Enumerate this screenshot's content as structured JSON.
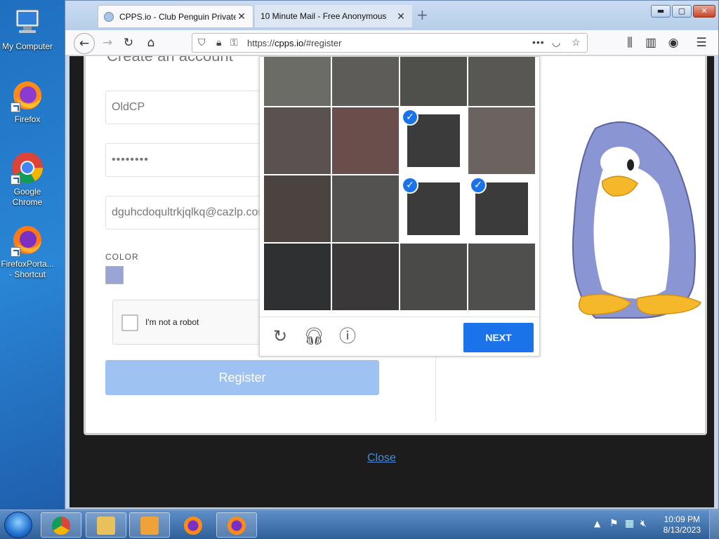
{
  "desktop": {
    "icons": [
      {
        "label": "My Computer",
        "icon": "computer-icon"
      },
      {
        "label": "Firefox",
        "icon": "firefox-icon"
      },
      {
        "label": "Google Chrome",
        "icon": "chrome-icon"
      },
      {
        "label": "FirefoxPorta... - Shortcut",
        "icon": "firefox-portable-icon"
      }
    ]
  },
  "browser": {
    "tabs": [
      {
        "title": "CPPS.io - Club Penguin Private",
        "active": true
      },
      {
        "title": "10 Minute Mail - Free Anonymous",
        "active": false
      }
    ],
    "url_prefix": "https://",
    "url_host": "cpps.io",
    "url_path": "/#register",
    "window_buttons": {
      "minimize": "▬",
      "maximize": "▢",
      "close": "✕"
    }
  },
  "register_form": {
    "heading": "Create an account",
    "username_value": "OldCP",
    "password_value": "••••••••",
    "email_value": "dguhcdoqultrkjqlkq@cazlp.com",
    "color_label": "COLOR",
    "swatch_color": "#9aa5d6",
    "recaptcha_label": "I'm not a robot",
    "register_label": "Register",
    "close_label": "Close"
  },
  "captcha": {
    "tiles": [
      false,
      false,
      false,
      false,
      false,
      false,
      true,
      false,
      false,
      false,
      true,
      true,
      false,
      false,
      false,
      false
    ],
    "next_label": "NEXT",
    "accent_color": "#1a73e8"
  },
  "taskbar": {
    "items": [
      "chrome-icon",
      "explorer-icon",
      "media-player-icon",
      "firefox-icon",
      "firefox-icon"
    ],
    "time": "10:09 PM",
    "date": "8/13/2023"
  }
}
